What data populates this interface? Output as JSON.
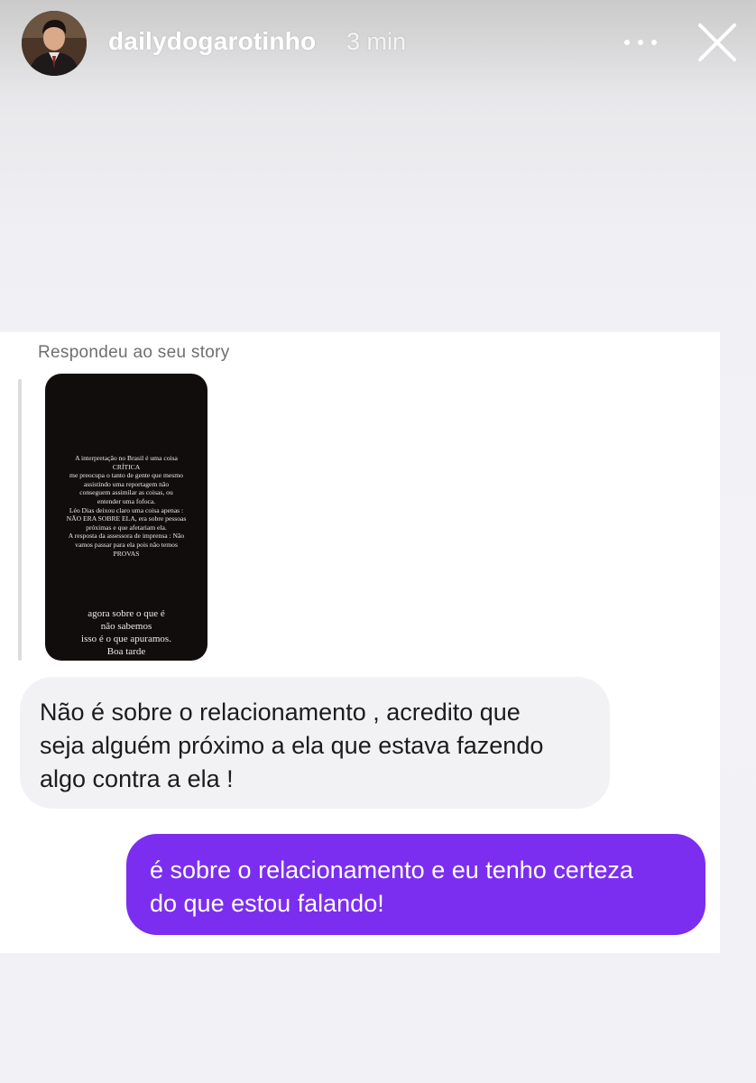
{
  "header": {
    "username": "dailydogarotinho",
    "time": "3 min",
    "avatar_icon": "profile-photo-man-in-suit",
    "more_icon": "more-horizontal-icon",
    "close_icon": "close-icon"
  },
  "dm": {
    "replied_label": "Respondeu ao seu story",
    "story_thumbnail": {
      "small_lines": [
        "A interpretação no Brasil é uma coisa",
        "CRÍTICA",
        "me preocupa o tanto de gente que mesmo",
        "assistindo uma reportagem não",
        "conseguem assimilar as coisas, ou",
        "entender uma fofoca.",
        "Léo Dias deixou claro uma coisa apenas :",
        "NÃO ERA SOBRE ELA, era sobre pessoas",
        "próximas e que afetariam ela.",
        "A resposta da assessora de imprensa : Não",
        "vamos passar para ela pois não temos",
        "PROVAS"
      ],
      "large_lines": [
        "agora sobre o que é",
        "não sabemos",
        "isso é o que apuramos.",
        "Boa tarde"
      ]
    },
    "messages": [
      {
        "direction": "incoming",
        "lines": [
          "Não é sobre o relacionamento , acredito que",
          "seja alguém próximo a ela que estava fazendo",
          "algo contra a ela !"
        ]
      },
      {
        "direction": "outgoing",
        "lines": [
          "é sobre o relacionamento e eu tenho certeza",
          "do que estou falando!"
        ]
      }
    ]
  },
  "colors": {
    "outgoing_bubble": "#7b2ef0",
    "incoming_bubble": "#f2f2f5",
    "story_bg": "#120d0d"
  }
}
